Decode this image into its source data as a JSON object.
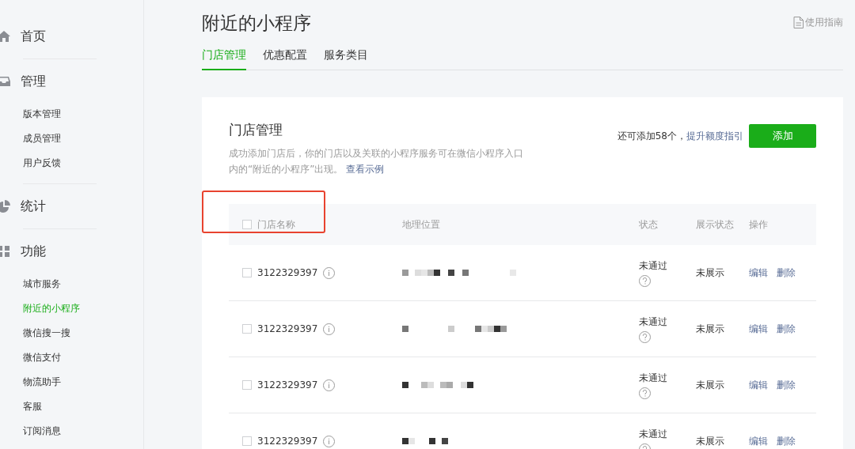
{
  "sidebar": {
    "sections": [
      {
        "label": "首页"
      },
      {
        "label": "管理",
        "items": [
          {
            "label": "版本管理",
            "selected": false
          },
          {
            "label": "成员管理",
            "selected": false
          },
          {
            "label": "用户反馈",
            "selected": false
          }
        ]
      },
      {
        "label": "统计"
      },
      {
        "label": "功能",
        "items": [
          {
            "label": "城市服务",
            "selected": false
          },
          {
            "label": "附近的小程序",
            "selected": true
          },
          {
            "label": "微信搜一搜",
            "selected": false
          },
          {
            "label": "微信支付",
            "selected": false
          },
          {
            "label": "物流助手",
            "selected": false
          },
          {
            "label": "客服",
            "selected": false
          },
          {
            "label": "订阅消息",
            "selected": false
          }
        ]
      }
    ]
  },
  "page": {
    "title": "附近的小程序",
    "help_link": "使用指南"
  },
  "tabs": [
    {
      "label": "门店管理",
      "selected": true
    },
    {
      "label": "优惠配置",
      "selected": false
    },
    {
      "label": "服务类目",
      "selected": false
    }
  ],
  "card": {
    "title": "门店管理",
    "description": "成功添加门店后，你的门店以及关联的小程序服务可在微信小程序入口内的“附近的小程序”出现。",
    "example_link": "查看示例",
    "quota_text": "还可添加58个，",
    "quota_link": "提升额度指引",
    "add_button": "添加"
  },
  "table": {
    "select_all": {
      "checked": false
    },
    "columns": [
      "门店名称",
      "地理位置",
      "状态",
      "展示状态",
      "操作"
    ],
    "rows": [
      {
        "checked": false,
        "name": "3122329397",
        "status": "未通过",
        "display_status": "未展示",
        "actions": [
          "编辑",
          "删除"
        ]
      },
      {
        "checked": false,
        "name": "3122329397",
        "status": "未通过",
        "display_status": "未展示",
        "actions": [
          "编辑",
          "删除"
        ]
      },
      {
        "checked": false,
        "name": "3122329397",
        "status": "未通过",
        "display_status": "未展示",
        "actions": [
          "编辑",
          "删除"
        ]
      },
      {
        "checked": false,
        "name": "3122329397",
        "status": "未通过",
        "display_status": "未展示",
        "actions": [
          "编辑",
          "删除"
        ]
      }
    ]
  }
}
